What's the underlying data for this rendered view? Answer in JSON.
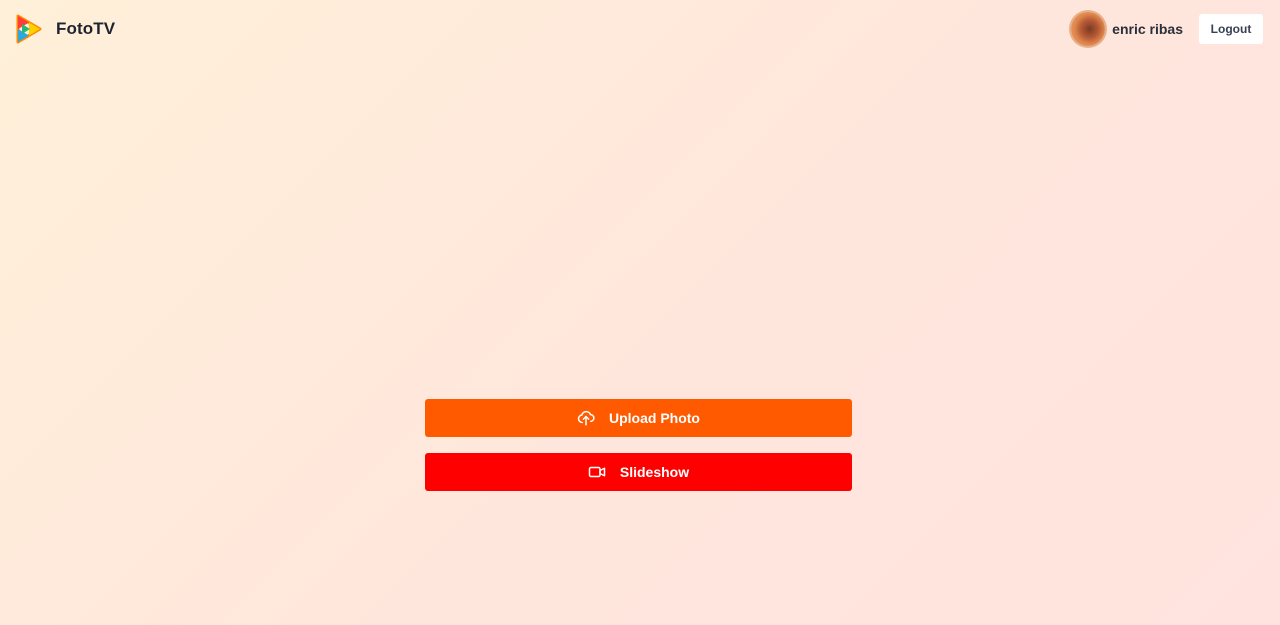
{
  "app": {
    "name": "FotoTV",
    "logo_icon": "fototv-play-logo-icon"
  },
  "user": {
    "name": "enric ribas",
    "avatar_icon": "user-avatar"
  },
  "header": {
    "logout_label": "Logout"
  },
  "actions": {
    "upload": {
      "label": "Upload Photo",
      "icon": "cloud-upload-icon",
      "color": "#ff5a00"
    },
    "slideshow": {
      "label": "Slideshow",
      "icon": "video-camera-icon",
      "color": "#ff0000"
    }
  },
  "colors": {
    "background_start": "#fff0d9",
    "background_end": "#ffe3df",
    "logout_bg": "#ffffff"
  }
}
